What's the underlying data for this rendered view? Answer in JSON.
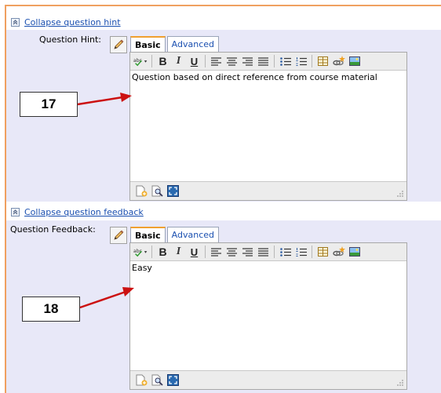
{
  "hint_section": {
    "collapse_link": "Collapse question hint",
    "field_label": "Question Hint:",
    "tabs": {
      "basic": "Basic",
      "advanced": "Advanced"
    },
    "content": "Question based on direct reference from course material",
    "callout": "17"
  },
  "feedback_section": {
    "collapse_link": "Collapse question feedback",
    "field_label": "Question Feedback:",
    "tabs": {
      "basic": "Basic",
      "advanced": "Advanced"
    },
    "content": "Easy",
    "callout": "18"
  },
  "toolbar_labels": {
    "bold": "B",
    "italic": "I",
    "underline": "U"
  },
  "colors": {
    "panel_bg": "#e8e8f8",
    "border_orange": "#f0a060",
    "link_blue": "#1a4fb0",
    "arrow_red": "#cc1111"
  }
}
